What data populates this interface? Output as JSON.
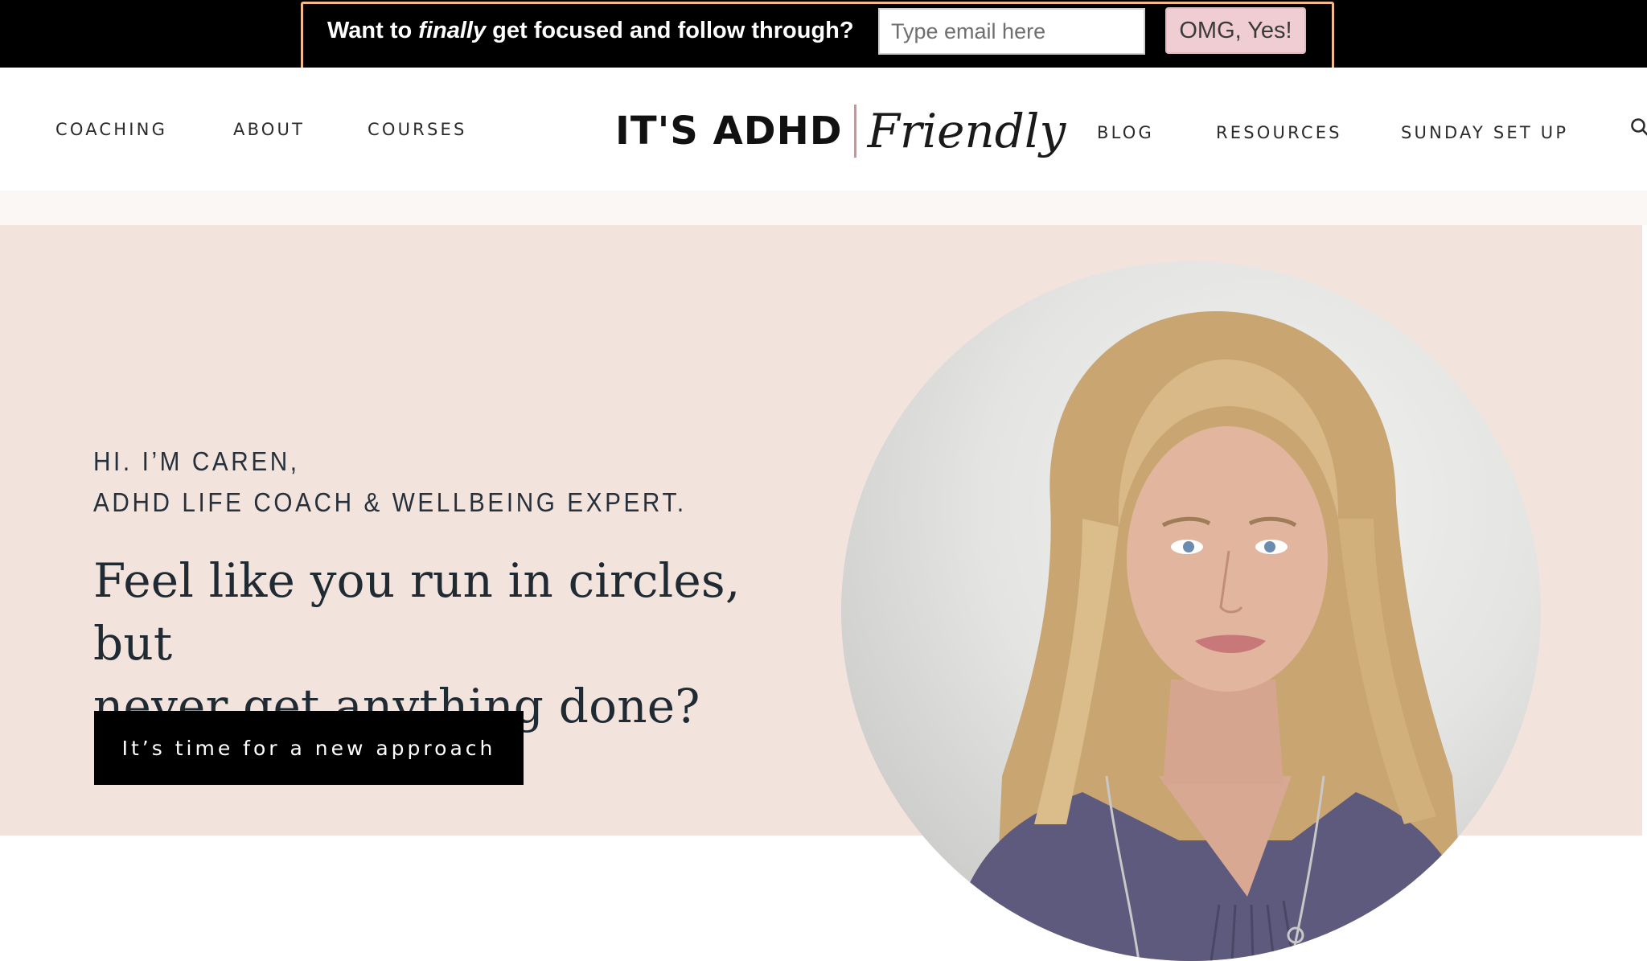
{
  "promo": {
    "text_before": "Want to ",
    "text_emphasis": "finally",
    "text_after": " get focused and follow through?",
    "email_placeholder": "Type email here",
    "button_label": "OMG, Yes!",
    "button_color": "#f0cdd2",
    "outline_color": "#f2b98a"
  },
  "nav": {
    "left": [
      {
        "label": "COACHING"
      },
      {
        "label": "ABOUT"
      },
      {
        "label": "COURSES"
      }
    ],
    "right": [
      {
        "label": "BLOG"
      },
      {
        "label": "RESOURCES"
      },
      {
        "label": "SUNDAY SET UP"
      }
    ],
    "search_icon": "search-icon"
  },
  "logo": {
    "main": "IT'S ADHD",
    "script": "Friendly"
  },
  "hero": {
    "intro_line1": "HI. I’M CAREN,",
    "intro_line2": "ADHD LIFE COACH & WELLBEING EXPERT.",
    "headline_line1": "Feel like you run in circles, but",
    "headline_line2": "never get anything done?",
    "cta_label": "It’s time for a new approach",
    "background_color": "#f3e3dd"
  }
}
